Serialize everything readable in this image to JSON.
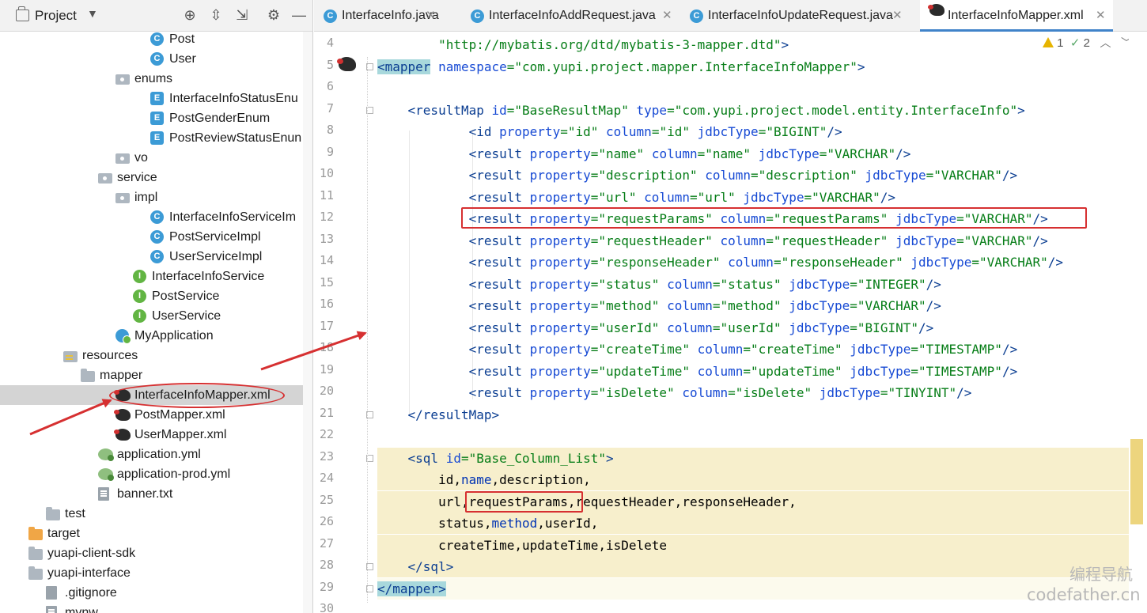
{
  "project_panel": {
    "title": "Project",
    "tree": [
      {
        "label": "Post",
        "icon": "class-icon",
        "glyph": "C"
      },
      {
        "label": "User",
        "icon": "class-icon",
        "glyph": "C"
      },
      {
        "label": "enums",
        "icon": "package-icon",
        "expanded": true
      },
      {
        "label": "InterfaceInfoStatusEnu",
        "icon": "enum-icon",
        "glyph": "E"
      },
      {
        "label": "PostGenderEnum",
        "icon": "enum-icon",
        "glyph": "E"
      },
      {
        "label": "PostReviewStatusEnun",
        "icon": "enum-icon",
        "glyph": "E"
      },
      {
        "label": "vo",
        "icon": "package-icon",
        "expanded": false
      },
      {
        "label": "service",
        "icon": "package-icon",
        "expanded": true
      },
      {
        "label": "impl",
        "icon": "package-icon",
        "expanded": true
      },
      {
        "label": "InterfaceInfoServiceIm",
        "icon": "class-icon",
        "glyph": "C"
      },
      {
        "label": "PostServiceImpl",
        "icon": "class-icon",
        "glyph": "C"
      },
      {
        "label": "UserServiceImpl",
        "icon": "class-icon",
        "glyph": "C"
      },
      {
        "label": "InterfaceInfoService",
        "icon": "interface-icon",
        "glyph": "I"
      },
      {
        "label": "PostService",
        "icon": "interface-icon",
        "glyph": "I"
      },
      {
        "label": "UserService",
        "icon": "interface-icon",
        "glyph": "I"
      },
      {
        "label": "MyApplication",
        "icon": "spring-app-icon"
      },
      {
        "label": "resources",
        "icon": "resources-folder-icon",
        "expanded": true
      },
      {
        "label": "mapper",
        "icon": "folder-icon",
        "expanded": true
      },
      {
        "label": "InterfaceInfoMapper.xml",
        "icon": "mybatis-xml-icon",
        "selected": true
      },
      {
        "label": "PostMapper.xml",
        "icon": "mybatis-xml-icon"
      },
      {
        "label": "UserMapper.xml",
        "icon": "mybatis-xml-icon"
      },
      {
        "label": "application.yml",
        "icon": "yml-icon"
      },
      {
        "label": "application-prod.yml",
        "icon": "yml-icon"
      },
      {
        "label": "banner.txt",
        "icon": "text-file-icon"
      },
      {
        "label": "test",
        "icon": "folder-icon",
        "expanded": false
      },
      {
        "label": "target",
        "icon": "target-folder-icon",
        "expanded": false
      },
      {
        "label": "yuapi-client-sdk",
        "icon": "folder-icon",
        "expanded": false
      },
      {
        "label": "yuapi-interface",
        "icon": "folder-icon",
        "expanded": false
      },
      {
        "label": ".gitignore",
        "icon": "git-file-icon"
      },
      {
        "label": "mvnw",
        "icon": "text-file-icon"
      }
    ]
  },
  "tabs": [
    {
      "label": "InterfaceInfo.java",
      "icon": "class-icon",
      "active": false
    },
    {
      "label": "InterfaceInfoAddRequest.java",
      "icon": "class-icon",
      "active": false
    },
    {
      "label": "InterfaceInfoUpdateRequest.java",
      "icon": "class-icon",
      "active": false
    },
    {
      "label": "InterfaceInfoMapper.xml",
      "icon": "mybatis-xml-icon",
      "active": true
    }
  ],
  "inspections": {
    "warnings": "1",
    "checks": "2"
  },
  "code_lines": [
    {
      "n": "4",
      "segs": [
        [
          "",
          "        "
        ],
        [
          "v",
          "\"http://mybatis.org/dtd/mybatis-3-mapper.dtd\""
        ],
        [
          "t",
          ">"
        ]
      ]
    },
    {
      "n": "5",
      "segs": [
        [
          "t",
          "<mapper"
        ],
        [
          "",
          " "
        ],
        [
          "a",
          "namespace"
        ],
        [
          "v",
          "=\"com.yupi.project.mapper.InterfaceInfoMapper\""
        ],
        [
          "t",
          ">"
        ]
      ]
    },
    {
      "n": "6",
      "segs": []
    },
    {
      "n": "7",
      "segs": [
        [
          "",
          "    "
        ],
        [
          "t",
          "<resultMap"
        ],
        [
          "",
          " "
        ],
        [
          "a",
          "id"
        ],
        [
          "v",
          "=\"BaseResultMap\""
        ],
        [
          "",
          " "
        ],
        [
          "a",
          "type"
        ],
        [
          "v",
          "=\"com.yupi.project.model.entity.InterfaceInfo\""
        ],
        [
          "t",
          ">"
        ]
      ]
    },
    {
      "n": "8",
      "segs": [
        [
          "",
          "            "
        ],
        [
          "t",
          "<id"
        ],
        [
          "",
          " "
        ],
        [
          "a",
          "property"
        ],
        [
          "v",
          "=\"id\""
        ],
        [
          "",
          " "
        ],
        [
          "a",
          "column"
        ],
        [
          "v",
          "=\"id\""
        ],
        [
          "",
          " "
        ],
        [
          "a",
          "jdbcType"
        ],
        [
          "v",
          "=\"BIGINT\""
        ],
        [
          "t",
          "/>"
        ]
      ]
    },
    {
      "n": "9",
      "segs": [
        [
          "",
          "            "
        ],
        [
          "t",
          "<result"
        ],
        [
          "",
          " "
        ],
        [
          "a",
          "property"
        ],
        [
          "v",
          "=\"name\""
        ],
        [
          "",
          " "
        ],
        [
          "a",
          "column"
        ],
        [
          "v",
          "=\"name\""
        ],
        [
          "",
          " "
        ],
        [
          "a",
          "jdbcType"
        ],
        [
          "v",
          "=\"VARCHAR\""
        ],
        [
          "t",
          "/>"
        ]
      ]
    },
    {
      "n": "10",
      "segs": [
        [
          "",
          "            "
        ],
        [
          "t",
          "<result"
        ],
        [
          "",
          " "
        ],
        [
          "a",
          "property"
        ],
        [
          "v",
          "=\"description\""
        ],
        [
          "",
          " "
        ],
        [
          "a",
          "column"
        ],
        [
          "v",
          "=\"description\""
        ],
        [
          "",
          " "
        ],
        [
          "a",
          "jdbcType"
        ],
        [
          "v",
          "=\"VARCHAR\""
        ],
        [
          "t",
          "/>"
        ]
      ]
    },
    {
      "n": "11",
      "segs": [
        [
          "",
          "            "
        ],
        [
          "t",
          "<result"
        ],
        [
          "",
          " "
        ],
        [
          "a",
          "property"
        ],
        [
          "v",
          "=\"url\""
        ],
        [
          "",
          " "
        ],
        [
          "a",
          "column"
        ],
        [
          "v",
          "=\"url\""
        ],
        [
          "",
          " "
        ],
        [
          "a",
          "jdbcType"
        ],
        [
          "v",
          "=\"VARCHAR\""
        ],
        [
          "t",
          "/>"
        ]
      ]
    },
    {
      "n": "12",
      "segs": [
        [
          "",
          "            "
        ],
        [
          "t",
          "<result"
        ],
        [
          "",
          " "
        ],
        [
          "a",
          "property"
        ],
        [
          "v",
          "=\"requestParams\""
        ],
        [
          "",
          " "
        ],
        [
          "a",
          "column"
        ],
        [
          "v",
          "=\"requestParams\""
        ],
        [
          "",
          " "
        ],
        [
          "a",
          "jdbcType"
        ],
        [
          "v",
          "=\"VARCHAR\""
        ],
        [
          "t",
          "/>"
        ]
      ]
    },
    {
      "n": "13",
      "segs": [
        [
          "",
          "            "
        ],
        [
          "t",
          "<result"
        ],
        [
          "",
          " "
        ],
        [
          "a",
          "property"
        ],
        [
          "v",
          "=\"requestHeader\""
        ],
        [
          "",
          " "
        ],
        [
          "a",
          "column"
        ],
        [
          "v",
          "=\"requestHeader\""
        ],
        [
          "",
          " "
        ],
        [
          "a",
          "jdbcType"
        ],
        [
          "v",
          "=\"VARCHAR\""
        ],
        [
          "t",
          "/>"
        ]
      ]
    },
    {
      "n": "14",
      "segs": [
        [
          "",
          "            "
        ],
        [
          "t",
          "<result"
        ],
        [
          "",
          " "
        ],
        [
          "a",
          "property"
        ],
        [
          "v",
          "=\"responseHeader\""
        ],
        [
          "",
          " "
        ],
        [
          "a",
          "column"
        ],
        [
          "v",
          "=\"responseHeader\""
        ],
        [
          "",
          " "
        ],
        [
          "a",
          "jdbcType"
        ],
        [
          "v",
          "=\"VARCHAR\""
        ],
        [
          "t",
          "/>"
        ]
      ]
    },
    {
      "n": "15",
      "segs": [
        [
          "",
          "            "
        ],
        [
          "t",
          "<result"
        ],
        [
          "",
          " "
        ],
        [
          "a",
          "property"
        ],
        [
          "v",
          "=\"status\""
        ],
        [
          "",
          " "
        ],
        [
          "a",
          "column"
        ],
        [
          "v",
          "=\"status\""
        ],
        [
          "",
          " "
        ],
        [
          "a",
          "jdbcType"
        ],
        [
          "v",
          "=\"INTEGER\""
        ],
        [
          "t",
          "/>"
        ]
      ]
    },
    {
      "n": "16",
      "segs": [
        [
          "",
          "            "
        ],
        [
          "t",
          "<result"
        ],
        [
          "",
          " "
        ],
        [
          "a",
          "property"
        ],
        [
          "v",
          "=\"method\""
        ],
        [
          "",
          " "
        ],
        [
          "a",
          "column"
        ],
        [
          "v",
          "=\"method\""
        ],
        [
          "",
          " "
        ],
        [
          "a",
          "jdbcType"
        ],
        [
          "v",
          "=\"VARCHAR\""
        ],
        [
          "t",
          "/>"
        ]
      ]
    },
    {
      "n": "17",
      "segs": [
        [
          "",
          "            "
        ],
        [
          "t",
          "<result"
        ],
        [
          "",
          " "
        ],
        [
          "a",
          "property"
        ],
        [
          "v",
          "=\"userId\""
        ],
        [
          "",
          " "
        ],
        [
          "a",
          "column"
        ],
        [
          "v",
          "=\"userId\""
        ],
        [
          "",
          " "
        ],
        [
          "a",
          "jdbcType"
        ],
        [
          "v",
          "=\"BIGINT\""
        ],
        [
          "t",
          "/>"
        ]
      ]
    },
    {
      "n": "18",
      "segs": [
        [
          "",
          "            "
        ],
        [
          "t",
          "<result"
        ],
        [
          "",
          " "
        ],
        [
          "a",
          "property"
        ],
        [
          "v",
          "=\"createTime\""
        ],
        [
          "",
          " "
        ],
        [
          "a",
          "column"
        ],
        [
          "v",
          "=\"createTime\""
        ],
        [
          "",
          " "
        ],
        [
          "a",
          "jdbcType"
        ],
        [
          "v",
          "=\"TIMESTAMP\""
        ],
        [
          "t",
          "/>"
        ]
      ]
    },
    {
      "n": "19",
      "segs": [
        [
          "",
          "            "
        ],
        [
          "t",
          "<result"
        ],
        [
          "",
          " "
        ],
        [
          "a",
          "property"
        ],
        [
          "v",
          "=\"updateTime\""
        ],
        [
          "",
          " "
        ],
        [
          "a",
          "column"
        ],
        [
          "v",
          "=\"updateTime\""
        ],
        [
          "",
          " "
        ],
        [
          "a",
          "jdbcType"
        ],
        [
          "v",
          "=\"TIMESTAMP\""
        ],
        [
          "t",
          "/>"
        ]
      ]
    },
    {
      "n": "20",
      "segs": [
        [
          "",
          "            "
        ],
        [
          "t",
          "<result"
        ],
        [
          "",
          " "
        ],
        [
          "a",
          "property"
        ],
        [
          "v",
          "=\"isDelete\""
        ],
        [
          "",
          " "
        ],
        [
          "a",
          "column"
        ],
        [
          "v",
          "=\"isDelete\""
        ],
        [
          "",
          " "
        ],
        [
          "a",
          "jdbcType"
        ],
        [
          "v",
          "=\"TINYINT\""
        ],
        [
          "t",
          "/>"
        ]
      ]
    },
    {
      "n": "21",
      "segs": [
        [
          "",
          "    "
        ],
        [
          "t",
          "</resultMap>"
        ]
      ]
    },
    {
      "n": "22",
      "segs": []
    },
    {
      "n": "23",
      "segs": [
        [
          "",
          "    "
        ],
        [
          "t",
          "<sql"
        ],
        [
          "",
          " "
        ],
        [
          "a",
          "id"
        ],
        [
          "v",
          "=\"Base_Column_List\""
        ],
        [
          "t",
          ">"
        ]
      ]
    },
    {
      "n": "24",
      "segs": [
        [
          "",
          "        id,"
        ],
        [
          "kw",
          "name"
        ],
        [
          "",
          ",description,"
        ]
      ]
    },
    {
      "n": "25",
      "segs": [
        [
          "",
          "        url,requestParams,requestHeader,responseHeader,"
        ]
      ]
    },
    {
      "n": "26",
      "segs": [
        [
          "",
          "        status,"
        ],
        [
          "kw",
          "method"
        ],
        [
          "",
          ",userId,"
        ]
      ]
    },
    {
      "n": "27",
      "segs": [
        [
          "",
          "        createTime,updateTime,isDelete"
        ]
      ]
    },
    {
      "n": "28",
      "segs": [
        [
          "",
          "    "
        ],
        [
          "t",
          "</sql>"
        ]
      ]
    },
    {
      "n": "29",
      "segs": [
        [
          "t",
          "</mapper>"
        ]
      ]
    },
    {
      "n": "30",
      "segs": []
    }
  ],
  "watermark": {
    "cn": "编程导航",
    "en": "codefather.cn"
  },
  "colors": {
    "accent": "#4083c9",
    "annotation": "#d63031",
    "sql_highlight": "#f7efcc",
    "warning": "#e6b400"
  }
}
